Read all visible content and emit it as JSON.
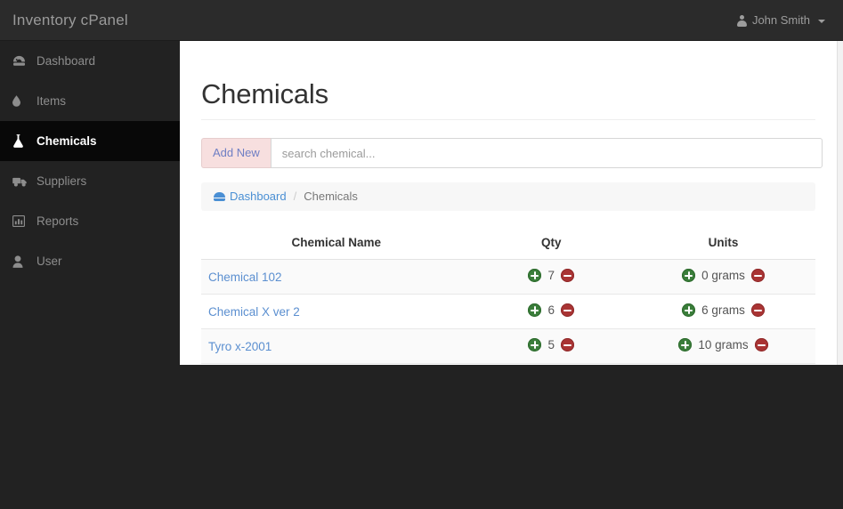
{
  "topbar": {
    "brand": "Inventory cPanel",
    "user_name": "John Smith",
    "user_icon": "person-icon",
    "caret_icon": "caret-down-icon",
    "bg_color": "#2b2b2b"
  },
  "sidebar": {
    "bg_color": "#222222",
    "active_bg_color": "#080808",
    "items": [
      {
        "label": "Dashboard",
        "icon": "gauge-icon",
        "glyph": "⚫",
        "active": false
      },
      {
        "label": "Items",
        "icon": "droplet-icon",
        "glyph": "●",
        "active": false
      },
      {
        "label": "Chemicals",
        "icon": "flask-icon",
        "glyph": "▲",
        "active": true
      },
      {
        "label": "Suppliers",
        "icon": "truck-icon",
        "glyph": "▬",
        "active": false
      },
      {
        "label": "Reports",
        "icon": "bar-chart-icon",
        "glyph": "▐",
        "active": false
      },
      {
        "label": "User",
        "icon": "person-icon",
        "glyph": "●",
        "active": false
      }
    ]
  },
  "main": {
    "page_title": "Chemicals",
    "toolbar": {
      "add_new_label": "Add New",
      "add_new_bg": "#f7dfdf",
      "add_new_text_color": "#6f7fc4",
      "search_placeholder": "search chemical...",
      "search_value": ""
    },
    "breadcrumb": {
      "home_label": "Dashboard",
      "home_icon": "gauge-icon",
      "separator": "/",
      "current_label": "Chemicals"
    },
    "table": {
      "headers": [
        "Chemical Name",
        "Qty",
        "Units"
      ],
      "increment_icon": "plus-circle-icon",
      "decrement_icon": "minus-circle-icon",
      "increment_color": "#3a7d3a",
      "decrement_color": "#a93434",
      "rows": [
        {
          "name": "Chemical 102",
          "qty": "7",
          "units": "0 grams"
        },
        {
          "name": "Chemical X ver 2",
          "qty": "6",
          "units": "6 grams"
        },
        {
          "name": "Tyro x-2001",
          "qty": "5",
          "units": "10 grams"
        }
      ]
    }
  }
}
